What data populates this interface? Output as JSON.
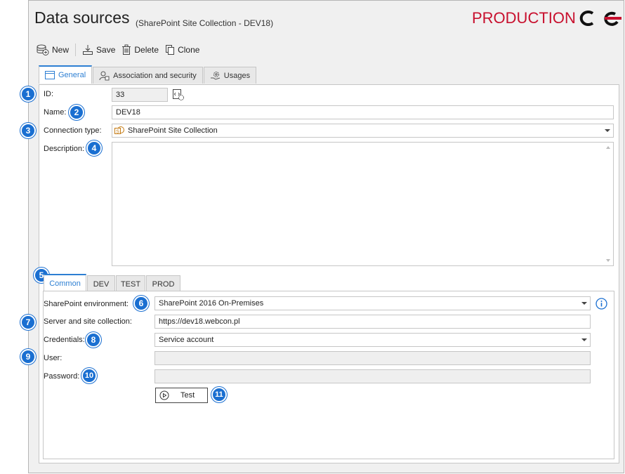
{
  "header": {
    "title": "Data sources",
    "subtitle": "(SharePoint Site Collection - DEV18)",
    "environment": "PRODUCTION",
    "env_color": "#c8102e"
  },
  "toolbar": {
    "new_label": "New",
    "save_label": "Save",
    "delete_label": "Delete",
    "clone_label": "Clone"
  },
  "tabs": [
    {
      "label": "General",
      "icon": "window-icon"
    },
    {
      "label": "Association and security",
      "icon": "user-lock-icon"
    },
    {
      "label": "Usages",
      "icon": "gear-hand-icon"
    }
  ],
  "form": {
    "id_label": "ID:",
    "id_value": "33",
    "name_label": "Name:",
    "name_value": "DEV18",
    "connection_type_label": "Connection type:",
    "connection_type_value": "SharePoint Site Collection",
    "description_label": "Description:",
    "description_value": ""
  },
  "subtabs": [
    "Common",
    "DEV",
    "TEST",
    "PROD"
  ],
  "common": {
    "sp_env_label": "SharePoint environment:",
    "sp_env_value": "SharePoint 2016 On-Premises",
    "server_label": "Server and site collection:",
    "server_value": "https://dev18.webcon.pl",
    "credentials_label": "Credentials:",
    "credentials_value": "Service account",
    "user_label": "User:",
    "user_value": "",
    "password_label": "Password:",
    "password_value": "",
    "test_label": "Test"
  },
  "badges": [
    "1",
    "2",
    "3",
    "4",
    "5",
    "6",
    "7",
    "8",
    "9",
    "10",
    "11"
  ],
  "colors": {
    "accent": "#2d7fd3",
    "badge": "#1a6fd1",
    "sharepoint": "#c47a12"
  }
}
